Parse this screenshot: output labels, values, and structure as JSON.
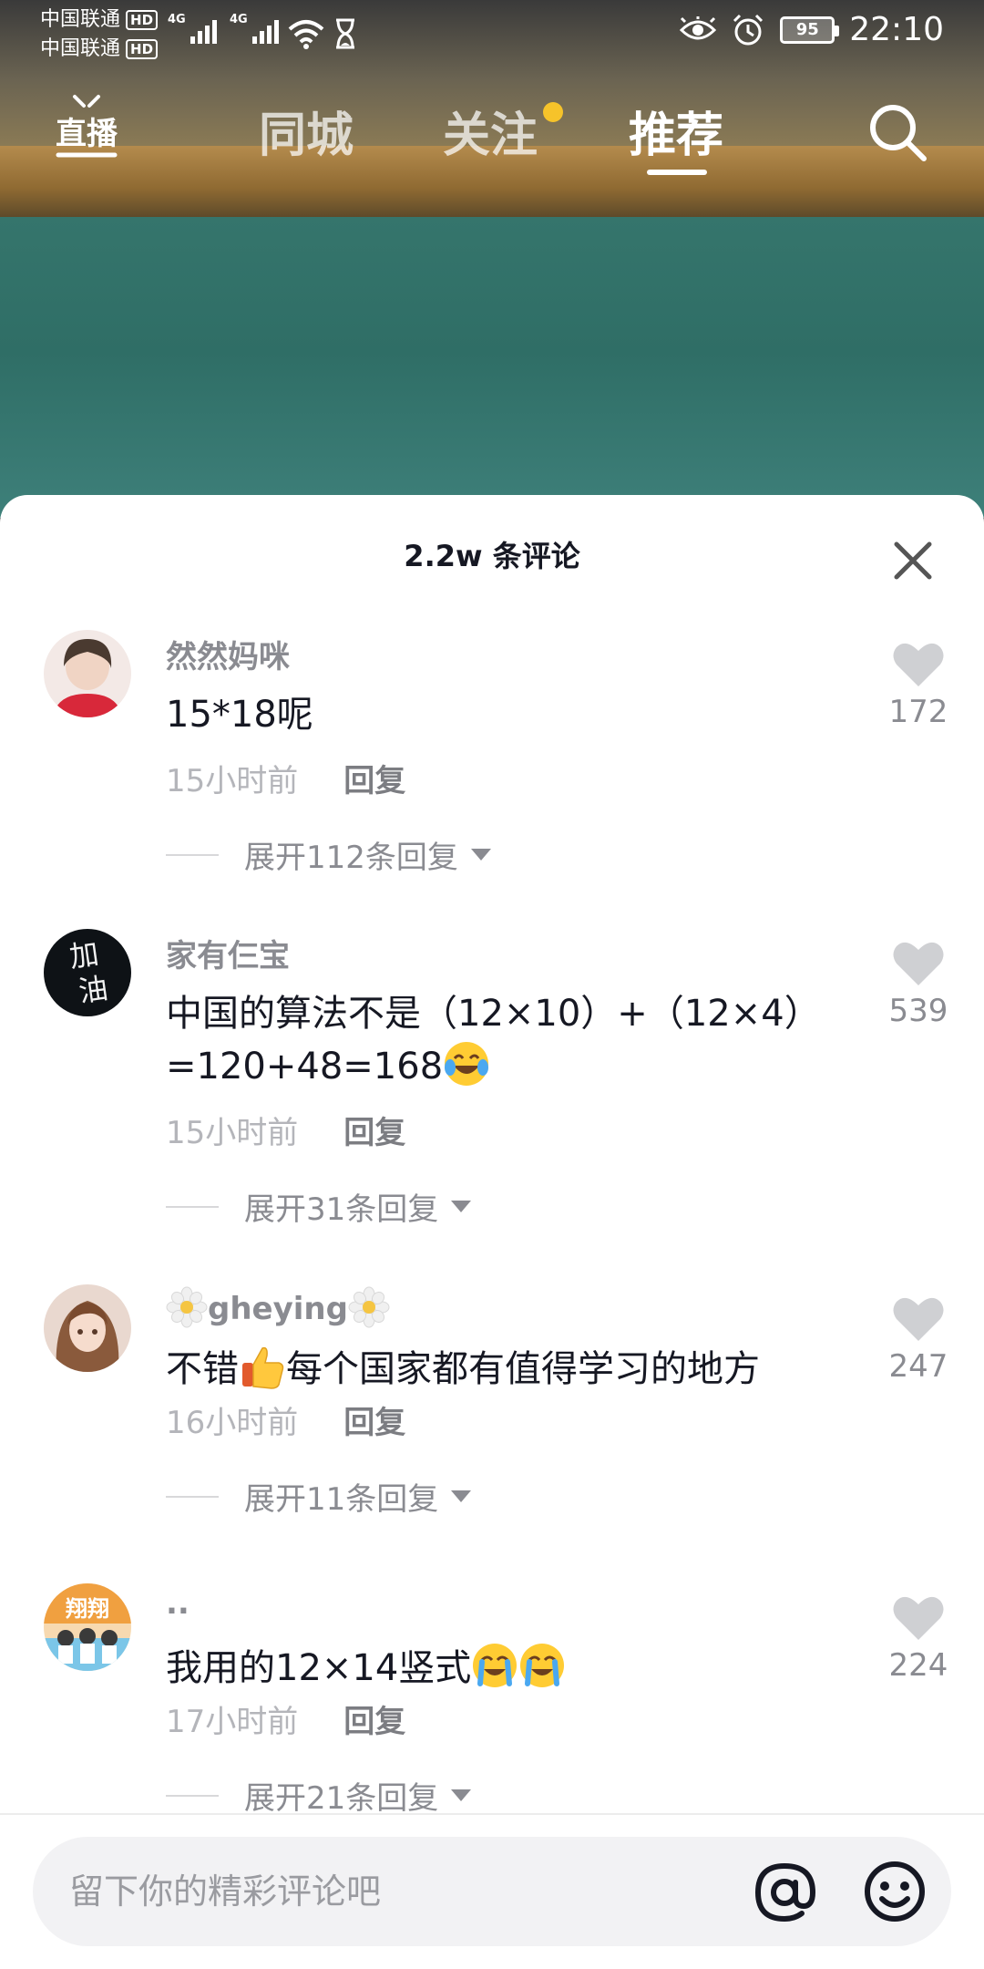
{
  "status_bar": {
    "carrier_1": "中国联通",
    "carrier_2": "中国联通",
    "hd": "HD",
    "network": "4G",
    "battery": "95",
    "time": "22:10"
  },
  "nav": {
    "live": "直播",
    "tabs": [
      "同城",
      "关注",
      "推荐"
    ],
    "active_tab": "推荐"
  },
  "comments_panel": {
    "title": "2.2w 条评论",
    "comments": [
      {
        "user": "然然妈咪",
        "text": "15*18呢",
        "time": "15小时前",
        "reply": "回复",
        "expand": "展开112条回复",
        "likes": "172"
      },
      {
        "user": "家有仨宝",
        "text": "中国的算法不是（12×10）+（12×4）=120+48=168",
        "time": "15小时前",
        "reply": "回复",
        "expand": "展开31条回复",
        "likes": "539"
      },
      {
        "user": "gheying",
        "text_before": "不错",
        "text_after": "每个国家都有值得学习的地方",
        "time": "16小时前",
        "reply": "回复",
        "expand": "展开11条回复",
        "likes": "247"
      },
      {
        "user": "..",
        "text": "我用的12×14竖式",
        "time": "17小时前",
        "reply": "回复",
        "expand": "展开21条回复",
        "likes": "224"
      }
    ]
  },
  "input": {
    "placeholder": "留下你的精彩评论吧"
  },
  "icons": {
    "heart": "heart-icon",
    "close": "close-icon",
    "search": "search-icon",
    "at": "at-icon",
    "emoji": "emoji-icon"
  },
  "colors": {
    "accent_dot": "#f6c32a",
    "text_primary": "#161823",
    "text_secondary": "#8a8b91",
    "heart": "#cfd0d3"
  }
}
